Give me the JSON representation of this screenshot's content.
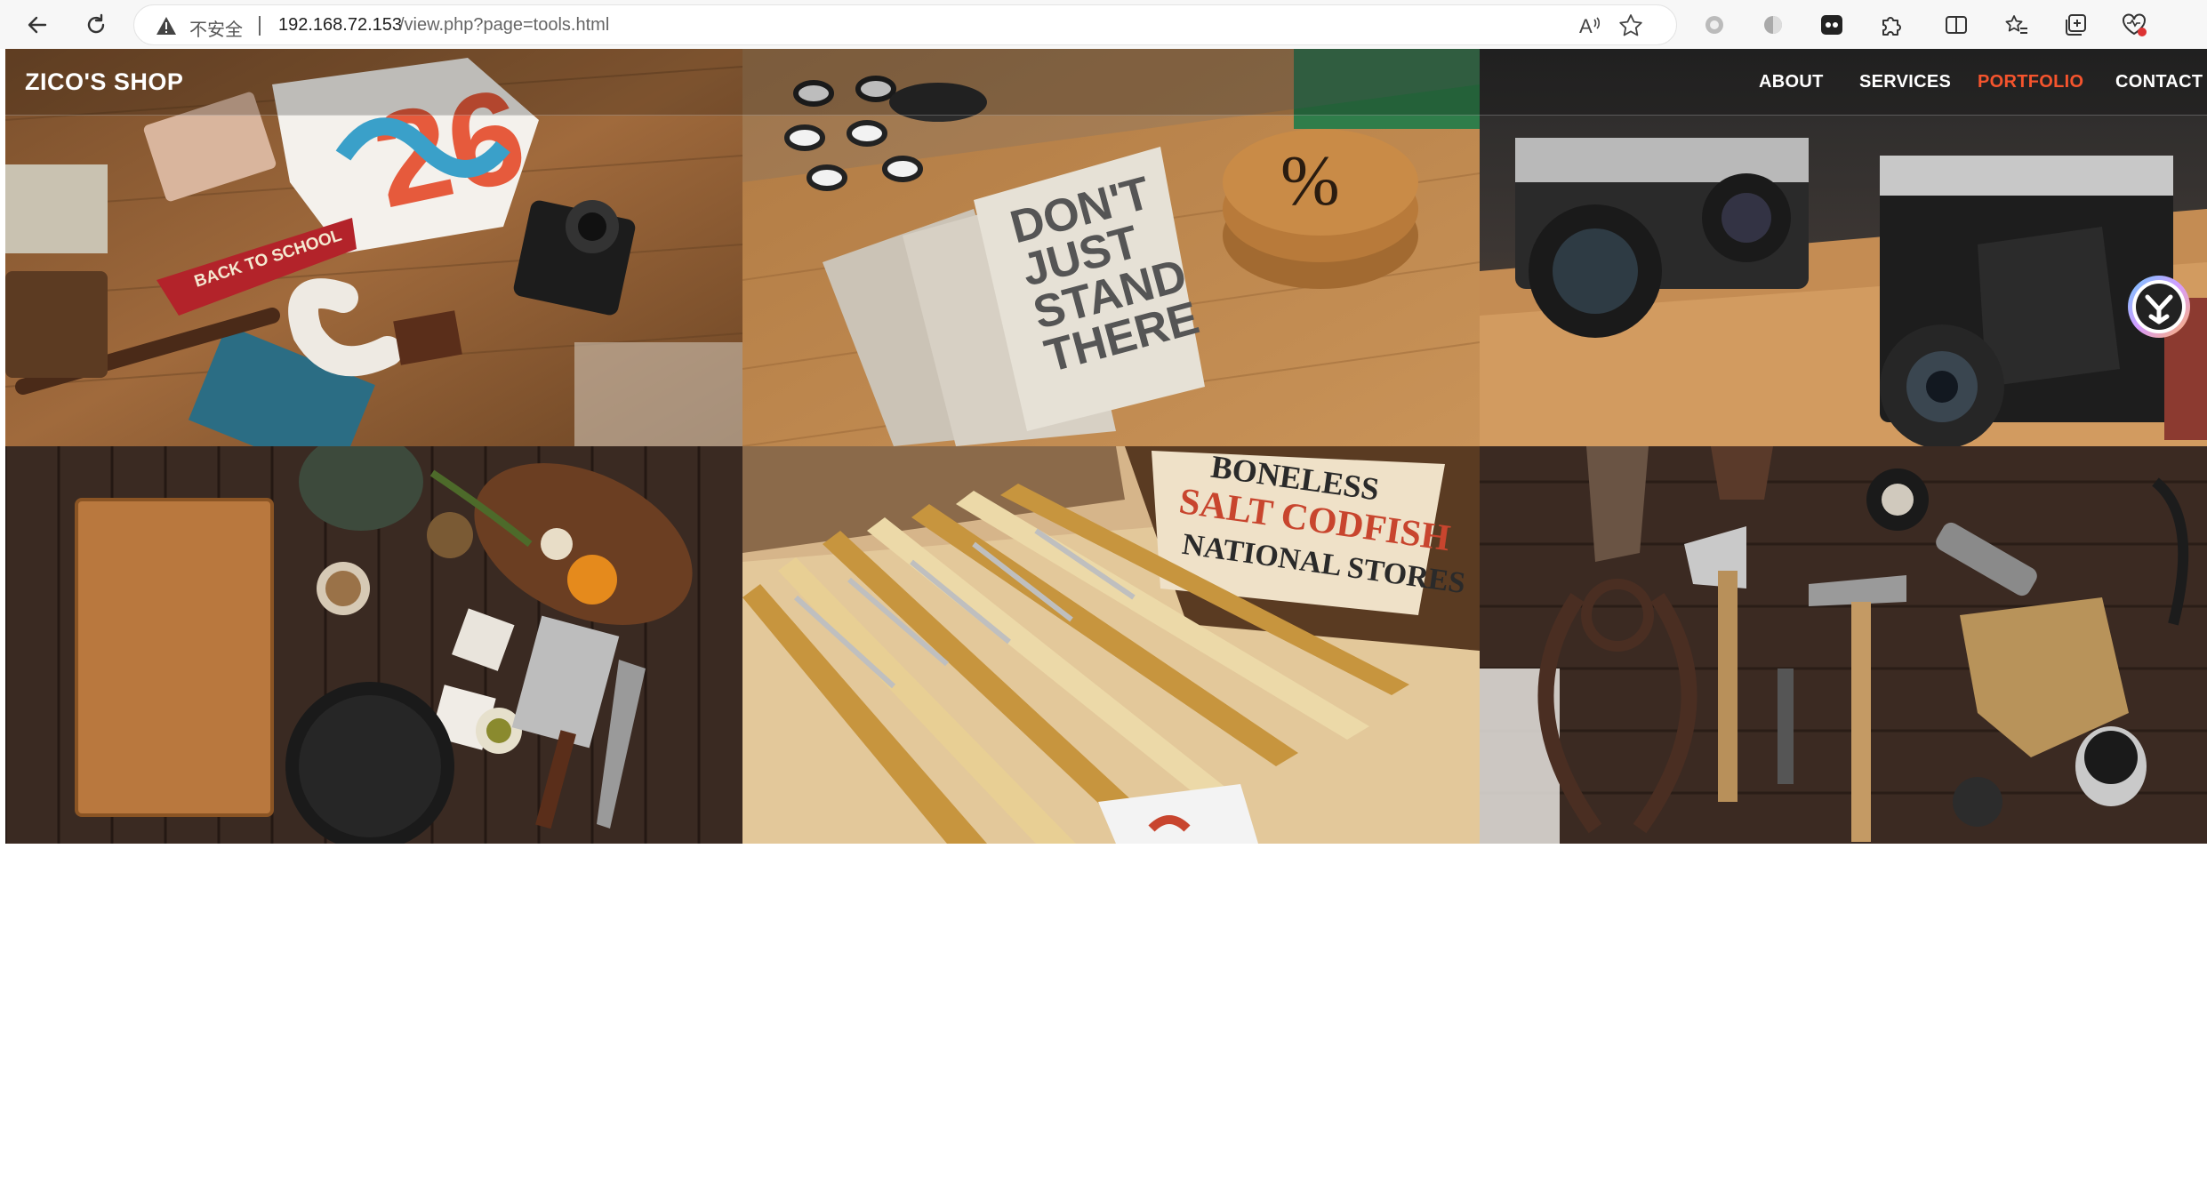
{
  "browser": {
    "security_label": "不安全",
    "url_host": "192.168.72.153",
    "url_path": "/view.php?page=tools.html",
    "read_aloud_icon_text": "A"
  },
  "site": {
    "brand": "ZICO'S SHOP",
    "nav": [
      {
        "label": "ABOUT",
        "active": false
      },
      {
        "label": "SERVICES",
        "active": false
      },
      {
        "label": "PORTFOLIO",
        "active": true
      },
      {
        "label": "CONTACT",
        "active": false
      }
    ],
    "accent_color": "#f5542d",
    "notebook_text": [
      "DON'T",
      "JUST",
      "STAND",
      "THERE"
    ],
    "pennant_text": "BACK TO SCHOOL",
    "box_text": [
      "BONELESS",
      "SALT CODFISH",
      "NATIONAL STORES"
    ],
    "tee_text": "26",
    "coaster_text": "%"
  }
}
